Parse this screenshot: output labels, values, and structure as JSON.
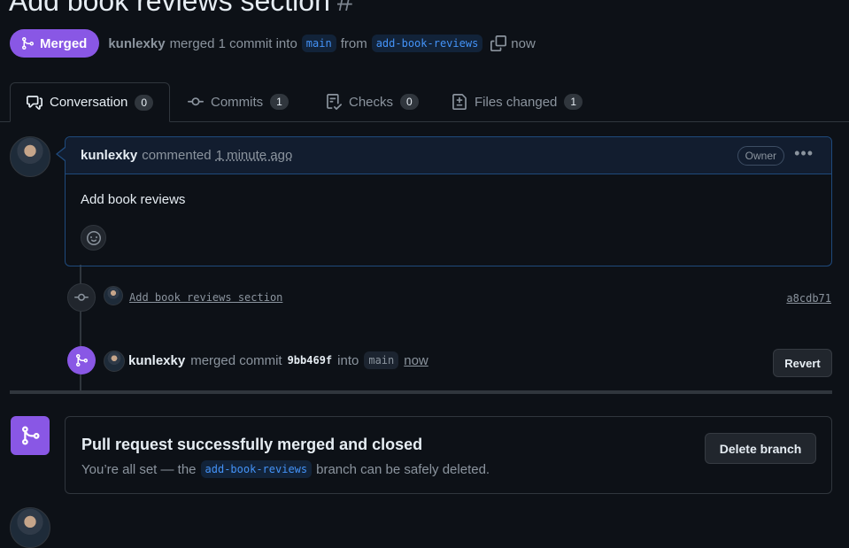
{
  "pr": {
    "title": "Add book reviews section",
    "number": "#",
    "state": "Merged",
    "author": "kunlexky",
    "merge_text": "merged 1 commit into",
    "base_branch": "main",
    "from_text": "from",
    "head_branch": "add-book-reviews",
    "time": "now"
  },
  "tabs": [
    {
      "label": "Conversation",
      "count": "0",
      "icon": "comment-discussion-icon"
    },
    {
      "label": "Commits",
      "count": "1",
      "icon": "git-commit-icon"
    },
    {
      "label": "Checks",
      "count": "0",
      "icon": "checklist-icon"
    },
    {
      "label": "Files changed",
      "count": "1",
      "icon": "file-diff-icon"
    }
  ],
  "comment": {
    "author": "kunlexky",
    "verb": "commented",
    "time": "1 minute ago",
    "role": "Owner",
    "menu": "•••",
    "body": "Add book reviews"
  },
  "commit_event": {
    "message": "Add book reviews section",
    "sha": "a8cdb71"
  },
  "merge_event": {
    "author": "kunlexky",
    "text1": "merged commit",
    "sha": "9bb469f",
    "text2": "into",
    "branch": "main",
    "time": "now",
    "revert_label": "Revert"
  },
  "merged_box": {
    "title": "Pull request successfully merged and closed",
    "sub_prefix": "You’re all set — the",
    "branch": "add-book-reviews",
    "sub_suffix": "branch can be safely deleted.",
    "delete_label": "Delete branch"
  },
  "colors": {
    "merged_purple": "#8957e5",
    "link_blue": "#4493f8",
    "background": "#0d1117"
  }
}
